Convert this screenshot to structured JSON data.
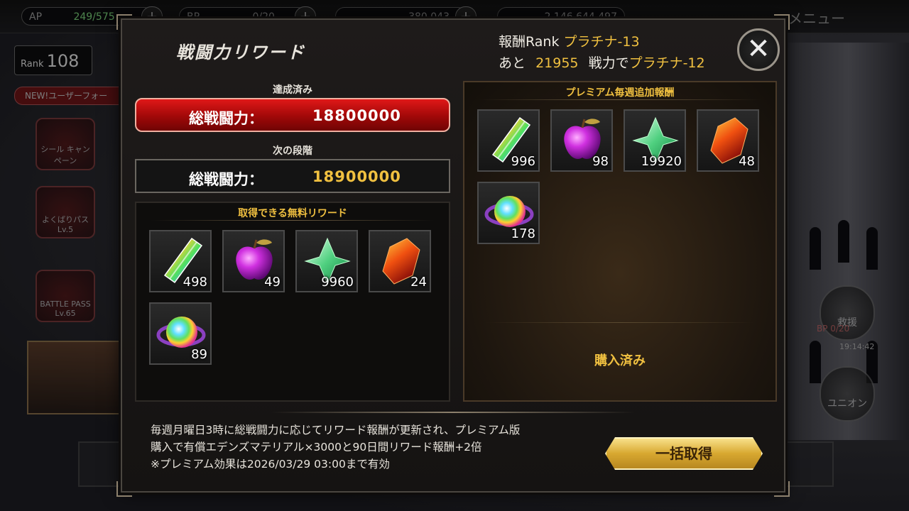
{
  "background": {
    "ap_label": "AP",
    "ap_value": "249/575",
    "bp_label": "BP",
    "bp_value": "0/20",
    "coins": "380,043",
    "gems": "2,146,644,497",
    "menu_label": "メニュー",
    "rank_label": "Rank",
    "rank_value": "108",
    "new_banner": "NEW!ユーザーフォー",
    "seal_campaign": "シール キャンペーン",
    "greedy_pass": "よくばりパス Lv.5",
    "battle_pass": "BATTLE PASS Lv.65",
    "rescue": "救援",
    "rescue_bp": "BP 0/20",
    "clock": "19:14:42",
    "union": "ユニオン"
  },
  "modal": {
    "title": "戦闘力リワード",
    "reward_rank_label": "報酬Rank",
    "reward_rank_value": "プラチナ-13",
    "next_prefix": "あと",
    "next_amount": "21955",
    "next_mid": "戦力で",
    "next_rank": "プラチナ-12",
    "achieved_label": "達成済み",
    "achieved_key": "総戦闘力：",
    "achieved_value": "18800000",
    "next_stage_label": "次の段階",
    "next_stage_key": "総戦闘力：",
    "next_stage_value": "18900000",
    "free_header": "取得できる無料リワード",
    "premium_header": "プレミアム毎週追加報酬",
    "purchased": "購入済み",
    "note_line1": "毎週月曜日3時に総戦闘力に応じてリワード報酬が更新され、プレミアム版",
    "note_line2": "購入で有償エデンズマテリアル×3000と90日間リワード報酬+2倍",
    "note_line3": "※プレミアム効果は2026/03/29 03:00まで有効",
    "collect_button": "一括取得",
    "close_icon": "close-icon"
  },
  "free_rewards": [
    {
      "icon": "rainbow-crystal-icon",
      "count": "498"
    },
    {
      "icon": "purple-apple-icon",
      "count": "49"
    },
    {
      "icon": "green-gem-icon",
      "count": "9960"
    },
    {
      "icon": "fire-stone-icon",
      "count": "24"
    },
    {
      "icon": "rainbow-orb-icon",
      "count": "89"
    }
  ],
  "premium_rewards": [
    {
      "icon": "rainbow-crystal-icon",
      "count": "996"
    },
    {
      "icon": "purple-apple-icon",
      "count": "98"
    },
    {
      "icon": "green-gem-icon",
      "count": "19920"
    },
    {
      "icon": "fire-stone-icon",
      "count": "48"
    },
    {
      "icon": "rainbow-orb-icon",
      "count": "178"
    }
  ],
  "colors": {
    "accent_gold": "#f0c040",
    "achieved_red": "#c01010"
  }
}
